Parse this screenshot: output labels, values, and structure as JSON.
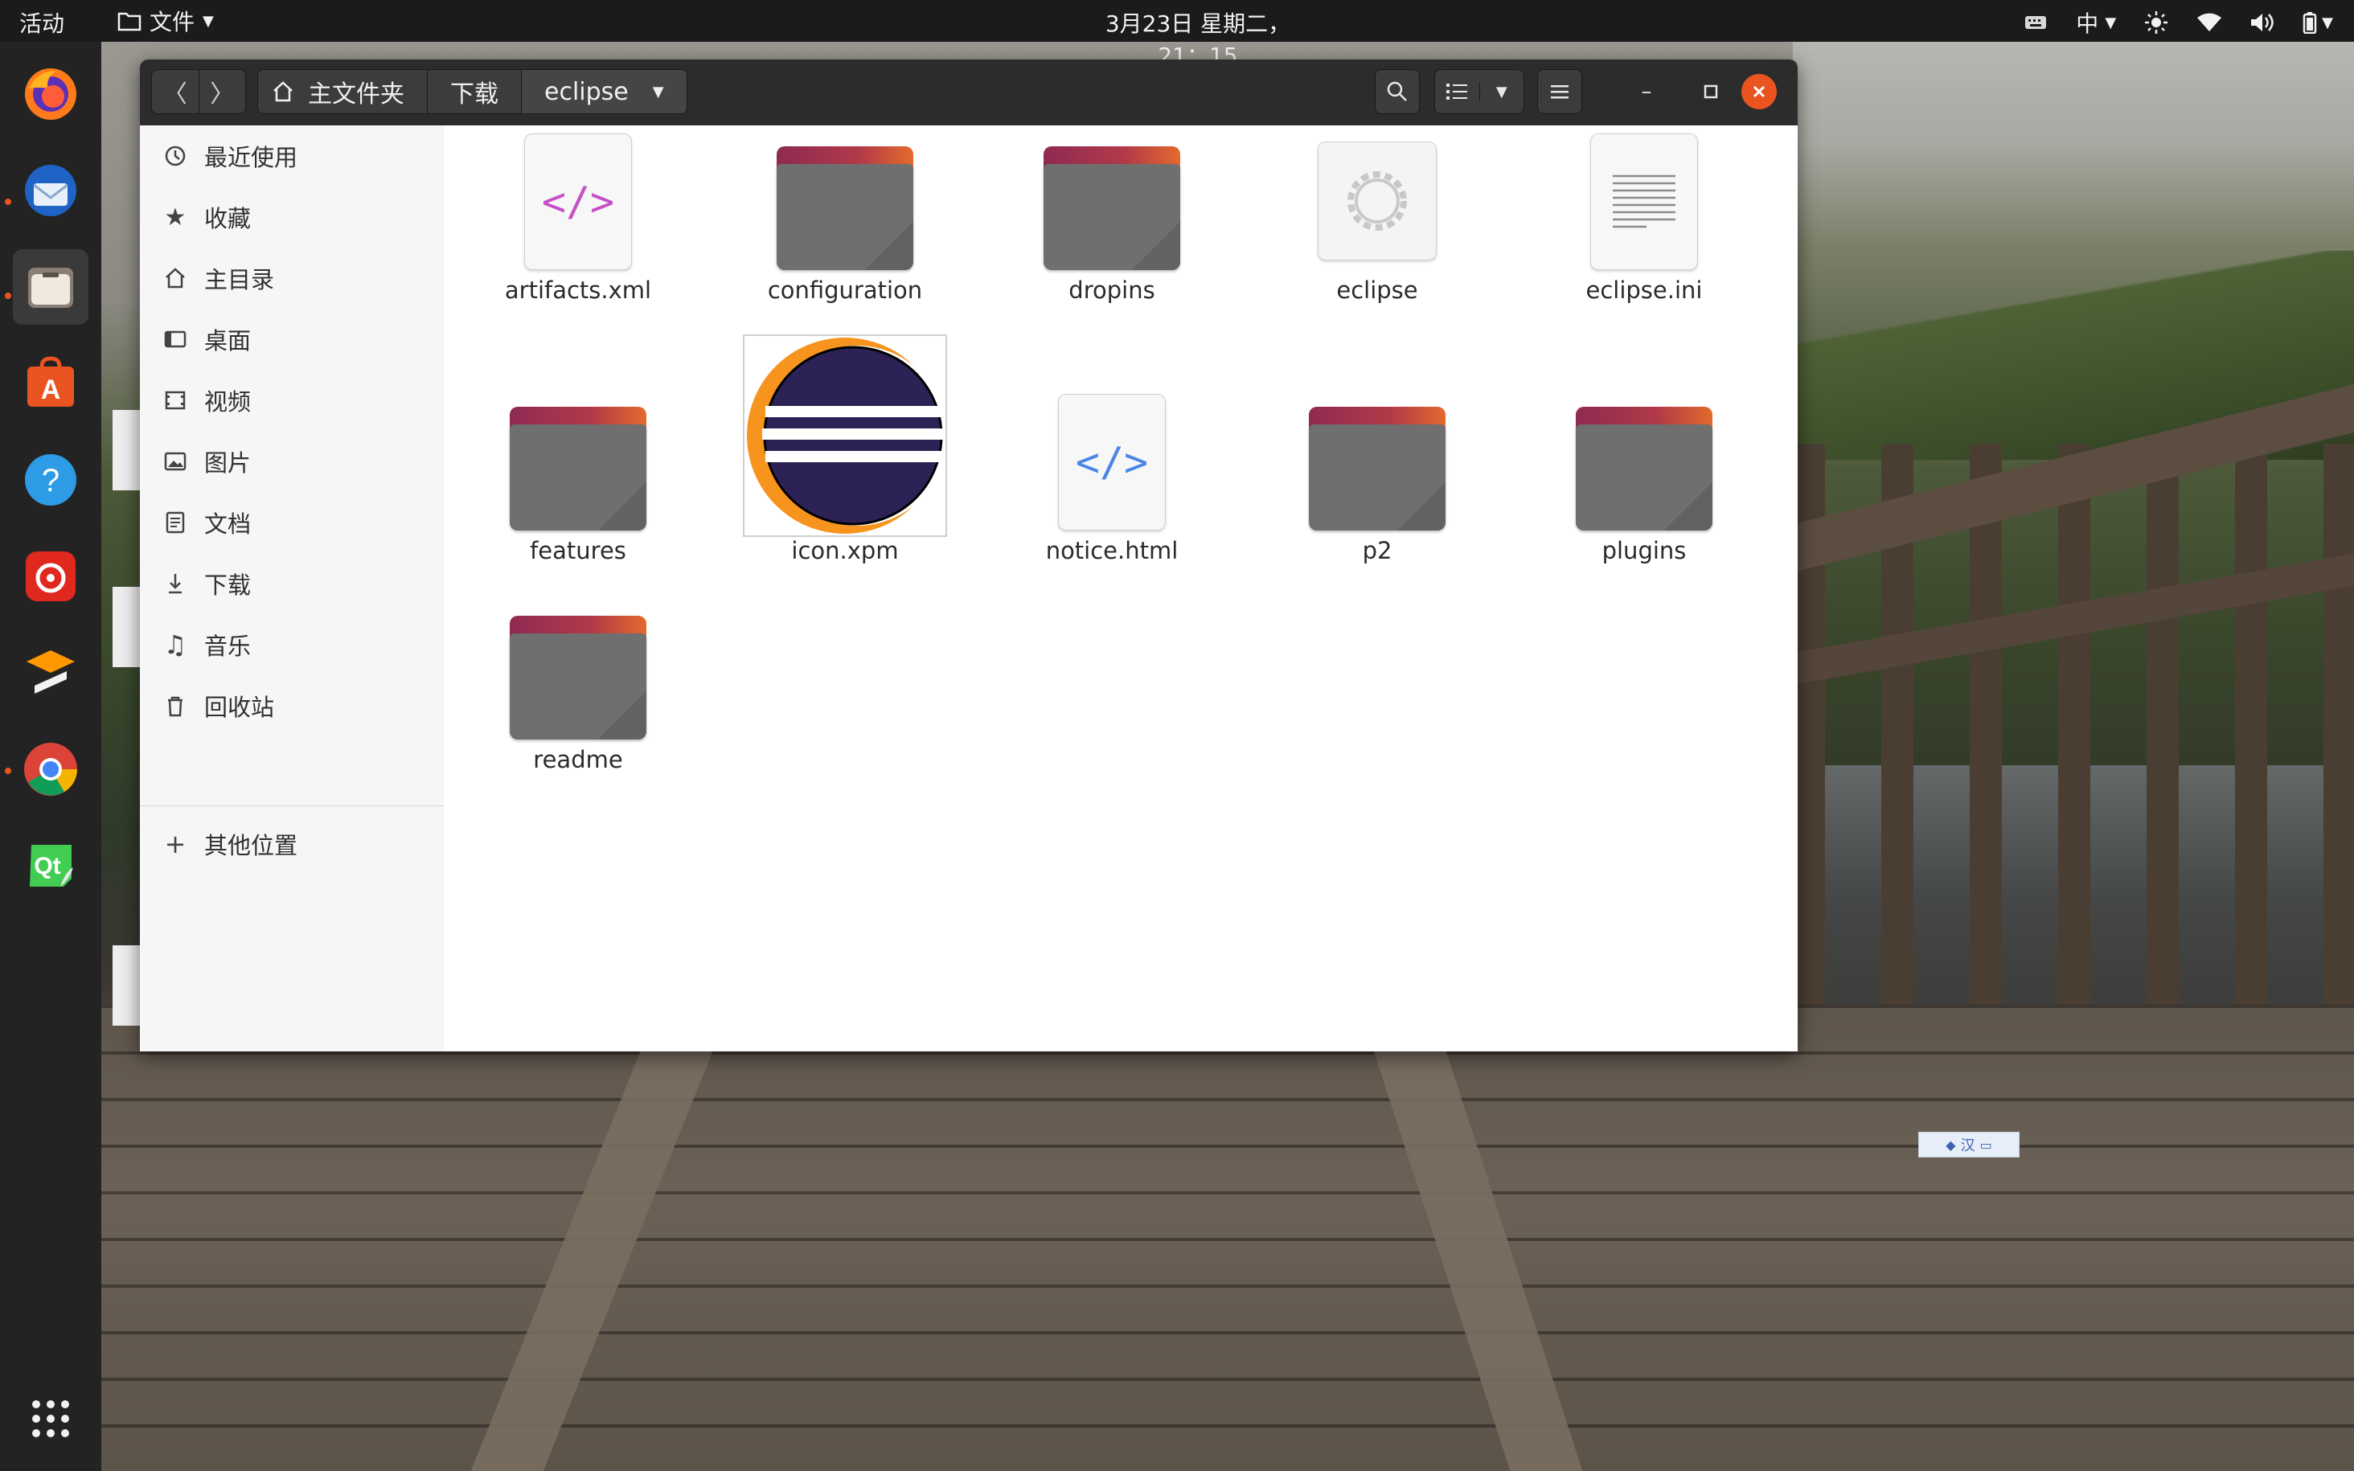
{
  "topbar": {
    "activities": "活动",
    "app_menu": "文件",
    "clock": "3月23日 星期二，21：15",
    "input_method": "中"
  },
  "dock": {
    "items": [
      {
        "name": "firefox-icon"
      },
      {
        "name": "thunderbird-icon"
      },
      {
        "name": "files-icon"
      },
      {
        "name": "software-center-icon"
      },
      {
        "name": "help-icon"
      },
      {
        "name": "netease-music-icon"
      },
      {
        "name": "sublime-text-icon"
      },
      {
        "name": "chrome-icon"
      },
      {
        "name": "qt-creator-icon"
      },
      {
        "name": "show-apps-icon"
      }
    ],
    "qt_label": "Qt"
  },
  "window": {
    "breadcrumbs": [
      "主文件夹",
      "下载",
      "eclipse"
    ],
    "sidebar": {
      "items": [
        {
          "label": "最近使用",
          "icon": "clock-icon"
        },
        {
          "label": "收藏",
          "icon": "star-icon"
        },
        {
          "label": "主目录",
          "icon": "home-icon"
        },
        {
          "label": "桌面",
          "icon": "desktop-icon"
        },
        {
          "label": "视频",
          "icon": "video-icon"
        },
        {
          "label": "图片",
          "icon": "image-icon"
        },
        {
          "label": "文档",
          "icon": "document-icon"
        },
        {
          "label": "下载",
          "icon": "download-icon"
        },
        {
          "label": "音乐",
          "icon": "music-icon"
        },
        {
          "label": "回收站",
          "icon": "trash-icon"
        }
      ],
      "other_locations": "其他位置"
    },
    "files": [
      {
        "name": "artifacts.xml",
        "type": "xml"
      },
      {
        "name": "configuration",
        "type": "folder"
      },
      {
        "name": "dropins",
        "type": "folder"
      },
      {
        "name": "eclipse",
        "type": "executable"
      },
      {
        "name": "eclipse.ini",
        "type": "text"
      },
      {
        "name": "features",
        "type": "folder"
      },
      {
        "name": "icon.xpm",
        "type": "image"
      },
      {
        "name": "notice.html",
        "type": "html"
      },
      {
        "name": "p2",
        "type": "folder"
      },
      {
        "name": "plugins",
        "type": "folder"
      },
      {
        "name": "readme",
        "type": "folder"
      }
    ]
  },
  "desktop_widget": {
    "label": "汉"
  },
  "colors": {
    "accent": "#e95420",
    "folder_gradient_start": "#8e2a52",
    "folder_gradient_end": "#e36a2c",
    "eclipse_purple": "#2c2255",
    "eclipse_orange": "#f7941e"
  }
}
